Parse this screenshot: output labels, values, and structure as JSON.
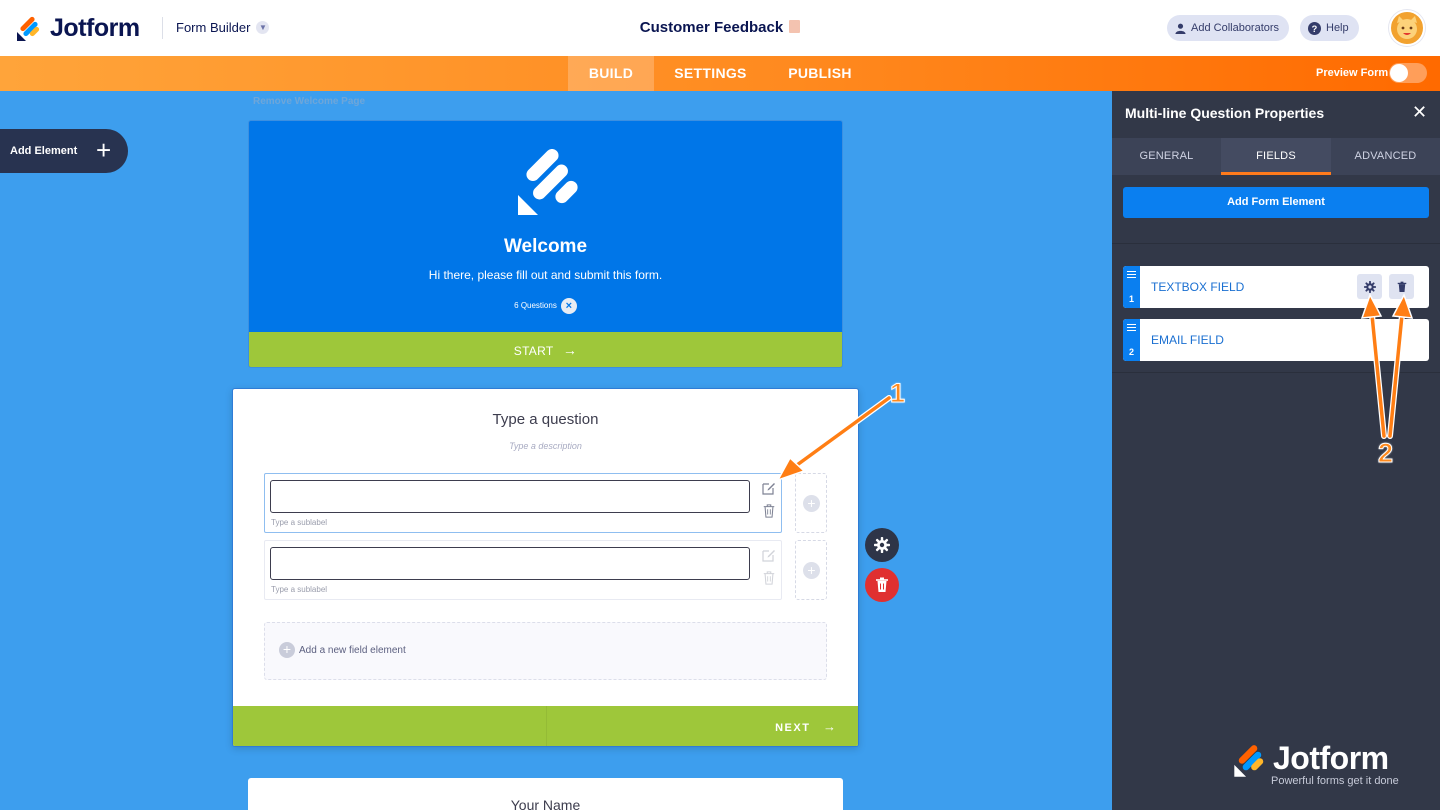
{
  "header": {
    "logo_text": "Jotform",
    "form_builder_label": "Form Builder",
    "form_title": "Customer Feedback",
    "add_collaborators": "Add Collaborators",
    "help": "Help"
  },
  "nav": {
    "tabs": [
      {
        "label": "BUILD",
        "active": true
      },
      {
        "label": "SETTINGS",
        "active": false
      },
      {
        "label": "PUBLISH",
        "active": false
      }
    ],
    "preview_label": "Preview Form",
    "preview_enabled": false
  },
  "canvas": {
    "add_element_label": "Add Element",
    "remove_welcome_label": "Remove Welcome Page",
    "welcome": {
      "title": "Welcome",
      "subtitle": "Hi there, please fill out and submit this form.",
      "question_count": "6 Questions",
      "start_label": "START"
    },
    "question": {
      "title": "Type a question",
      "description": "Type a description",
      "fields": [
        {
          "sublabel": "Type a sublabel"
        },
        {
          "sublabel": "Type a sublabel"
        }
      ],
      "add_field_label": "Add a new field element",
      "next_label": "NEXT"
    },
    "next_question_title": "Your Name"
  },
  "panel": {
    "title": "Multi-line Question Properties",
    "tabs": [
      {
        "label": "GENERAL",
        "active": false
      },
      {
        "label": "FIELDS",
        "active": true
      },
      {
        "label": "ADVANCED",
        "active": false
      }
    ],
    "add_form_element_label": "Add Form Element",
    "items": [
      {
        "number": "1",
        "label": "TEXTBOX FIELD"
      },
      {
        "number": "2",
        "label": "EMAIL FIELD"
      }
    ],
    "watermark_text": "Jotform",
    "watermark_tagline": "Powerful forms get it done"
  },
  "annotations": {
    "marker_1": "1",
    "marker_2": "2"
  },
  "colors": {
    "canvas_bg": "#3d9eee",
    "welcome_bg": "#0076e8",
    "green_bar": "#9ec73a",
    "panel_bg": "#323848",
    "accent_orange": "#ff7b1c",
    "primary_blue": "#0a7ff0",
    "delete_red": "#e03030"
  }
}
